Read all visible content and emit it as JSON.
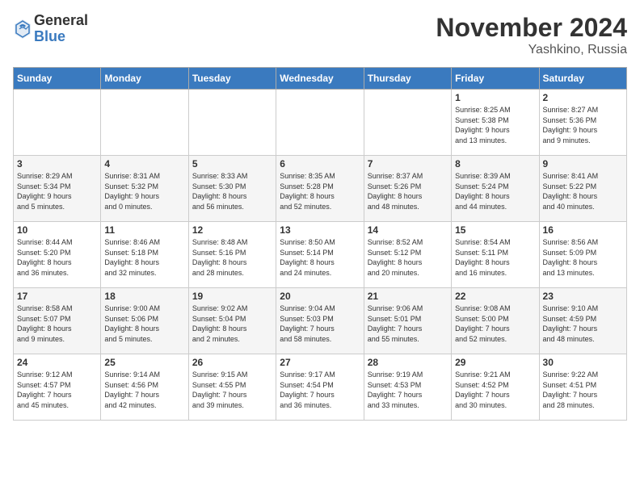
{
  "logo": {
    "general": "General",
    "blue": "Blue"
  },
  "title": {
    "month": "November 2024",
    "location": "Yashkino, Russia"
  },
  "weekdays": [
    "Sunday",
    "Monday",
    "Tuesday",
    "Wednesday",
    "Thursday",
    "Friday",
    "Saturday"
  ],
  "weeks": [
    [
      {
        "day": "",
        "info": ""
      },
      {
        "day": "",
        "info": ""
      },
      {
        "day": "",
        "info": ""
      },
      {
        "day": "",
        "info": ""
      },
      {
        "day": "",
        "info": ""
      },
      {
        "day": "1",
        "info": "Sunrise: 8:25 AM\nSunset: 5:38 PM\nDaylight: 9 hours\nand 13 minutes."
      },
      {
        "day": "2",
        "info": "Sunrise: 8:27 AM\nSunset: 5:36 PM\nDaylight: 9 hours\nand 9 minutes."
      }
    ],
    [
      {
        "day": "3",
        "info": "Sunrise: 8:29 AM\nSunset: 5:34 PM\nDaylight: 9 hours\nand 5 minutes."
      },
      {
        "day": "4",
        "info": "Sunrise: 8:31 AM\nSunset: 5:32 PM\nDaylight: 9 hours\nand 0 minutes."
      },
      {
        "day": "5",
        "info": "Sunrise: 8:33 AM\nSunset: 5:30 PM\nDaylight: 8 hours\nand 56 minutes."
      },
      {
        "day": "6",
        "info": "Sunrise: 8:35 AM\nSunset: 5:28 PM\nDaylight: 8 hours\nand 52 minutes."
      },
      {
        "day": "7",
        "info": "Sunrise: 8:37 AM\nSunset: 5:26 PM\nDaylight: 8 hours\nand 48 minutes."
      },
      {
        "day": "8",
        "info": "Sunrise: 8:39 AM\nSunset: 5:24 PM\nDaylight: 8 hours\nand 44 minutes."
      },
      {
        "day": "9",
        "info": "Sunrise: 8:41 AM\nSunset: 5:22 PM\nDaylight: 8 hours\nand 40 minutes."
      }
    ],
    [
      {
        "day": "10",
        "info": "Sunrise: 8:44 AM\nSunset: 5:20 PM\nDaylight: 8 hours\nand 36 minutes."
      },
      {
        "day": "11",
        "info": "Sunrise: 8:46 AM\nSunset: 5:18 PM\nDaylight: 8 hours\nand 32 minutes."
      },
      {
        "day": "12",
        "info": "Sunrise: 8:48 AM\nSunset: 5:16 PM\nDaylight: 8 hours\nand 28 minutes."
      },
      {
        "day": "13",
        "info": "Sunrise: 8:50 AM\nSunset: 5:14 PM\nDaylight: 8 hours\nand 24 minutes."
      },
      {
        "day": "14",
        "info": "Sunrise: 8:52 AM\nSunset: 5:12 PM\nDaylight: 8 hours\nand 20 minutes."
      },
      {
        "day": "15",
        "info": "Sunrise: 8:54 AM\nSunset: 5:11 PM\nDaylight: 8 hours\nand 16 minutes."
      },
      {
        "day": "16",
        "info": "Sunrise: 8:56 AM\nSunset: 5:09 PM\nDaylight: 8 hours\nand 13 minutes."
      }
    ],
    [
      {
        "day": "17",
        "info": "Sunrise: 8:58 AM\nSunset: 5:07 PM\nDaylight: 8 hours\nand 9 minutes."
      },
      {
        "day": "18",
        "info": "Sunrise: 9:00 AM\nSunset: 5:06 PM\nDaylight: 8 hours\nand 5 minutes."
      },
      {
        "day": "19",
        "info": "Sunrise: 9:02 AM\nSunset: 5:04 PM\nDaylight: 8 hours\nand 2 minutes."
      },
      {
        "day": "20",
        "info": "Sunrise: 9:04 AM\nSunset: 5:03 PM\nDaylight: 7 hours\nand 58 minutes."
      },
      {
        "day": "21",
        "info": "Sunrise: 9:06 AM\nSunset: 5:01 PM\nDaylight: 7 hours\nand 55 minutes."
      },
      {
        "day": "22",
        "info": "Sunrise: 9:08 AM\nSunset: 5:00 PM\nDaylight: 7 hours\nand 52 minutes."
      },
      {
        "day": "23",
        "info": "Sunrise: 9:10 AM\nSunset: 4:59 PM\nDaylight: 7 hours\nand 48 minutes."
      }
    ],
    [
      {
        "day": "24",
        "info": "Sunrise: 9:12 AM\nSunset: 4:57 PM\nDaylight: 7 hours\nand 45 minutes."
      },
      {
        "day": "25",
        "info": "Sunrise: 9:14 AM\nSunset: 4:56 PM\nDaylight: 7 hours\nand 42 minutes."
      },
      {
        "day": "26",
        "info": "Sunrise: 9:15 AM\nSunset: 4:55 PM\nDaylight: 7 hours\nand 39 minutes."
      },
      {
        "day": "27",
        "info": "Sunrise: 9:17 AM\nSunset: 4:54 PM\nDaylight: 7 hours\nand 36 minutes."
      },
      {
        "day": "28",
        "info": "Sunrise: 9:19 AM\nSunset: 4:53 PM\nDaylight: 7 hours\nand 33 minutes."
      },
      {
        "day": "29",
        "info": "Sunrise: 9:21 AM\nSunset: 4:52 PM\nDaylight: 7 hours\nand 30 minutes."
      },
      {
        "day": "30",
        "info": "Sunrise: 9:22 AM\nSunset: 4:51 PM\nDaylight: 7 hours\nand 28 minutes."
      }
    ]
  ]
}
